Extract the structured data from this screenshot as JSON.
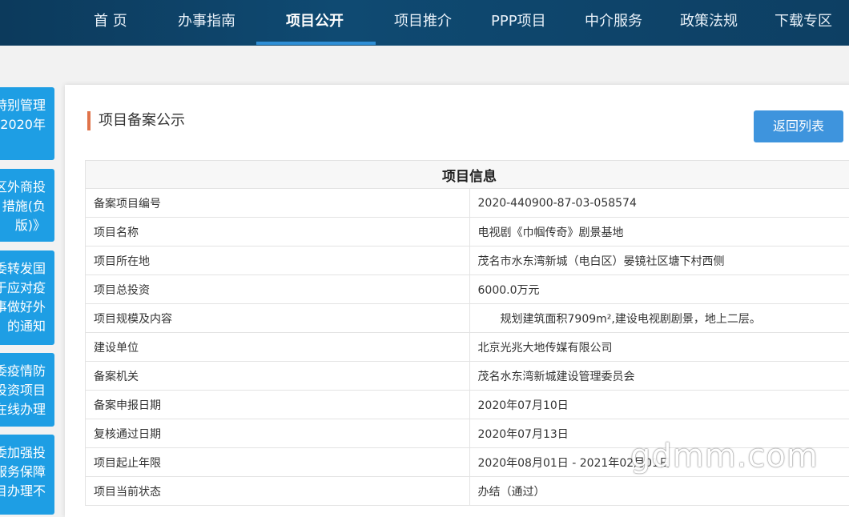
{
  "nav": {
    "items": [
      {
        "label": "首 页"
      },
      {
        "label": "办事指南"
      },
      {
        "label": "项目公开"
      },
      {
        "label": "项目推介"
      },
      {
        "label": "PPP项目"
      },
      {
        "label": "中介服务"
      },
      {
        "label": "政策法规"
      },
      {
        "label": "下载专区"
      }
    ],
    "active": "项目公开"
  },
  "sidebar": {
    "items": [
      {
        "lines": [
          "特别管理",
          "2020年"
        ]
      },
      {
        "lines": [
          "区外商投",
          "措施(负",
          "版)》"
        ]
      },
      {
        "lines": [
          "委转发国",
          "于应对疫",
          "事做好外",
          "的通知"
        ]
      },
      {
        "lines": [
          "委疫情防",
          "投资项目",
          "在线办理"
        ]
      },
      {
        "lines": [
          "委加强投",
          "服务保障",
          "目办理不"
        ]
      }
    ]
  },
  "panel": {
    "title": "项目备案公示",
    "back_label": "返回列表"
  },
  "table": {
    "header": "项目信息",
    "rows": [
      {
        "label": "备案项目编号",
        "value": "2020-440900-87-03-058574"
      },
      {
        "label": "项目名称",
        "value": "电视剧《巾帼传奇》剧景基地"
      },
      {
        "label": "项目所在地",
        "value": "茂名市水东湾新城（电白区）晏镜社区塘下村西侧"
      },
      {
        "label": "项目总投资",
        "value": "6000.0万元"
      },
      {
        "label": "项目规模及内容",
        "value": "规划建筑面积7909m²,建设电视剧剧景，地上二层。"
      },
      {
        "label": "建设单位",
        "value": "北京光兆大地传媒有限公司"
      },
      {
        "label": "备案机关",
        "value": "茂名水东湾新城建设管理委员会"
      },
      {
        "label": "备案申报日期",
        "value": "2020年07月10日"
      },
      {
        "label": "复核通过日期",
        "value": "2020年07月13日"
      },
      {
        "label": "项目起止年限",
        "value": "2020年08月01日 - 2021年02月01日"
      },
      {
        "label": "项目当前状态",
        "value": "办结（通过）"
      }
    ]
  },
  "watermark": "gdmm.com"
}
